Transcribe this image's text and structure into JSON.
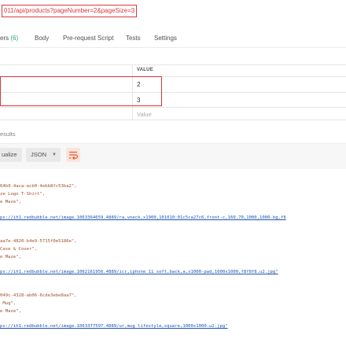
{
  "url_bar": {
    "url": "011/api/products?pageNumber=2&pageSize=3"
  },
  "tabs": [
    {
      "label": "ers ",
      "count": "(6)"
    },
    {
      "label": "Body"
    },
    {
      "label": "Pre-request Script"
    },
    {
      "label": "Tests"
    },
    {
      "label": "Settings"
    }
  ],
  "params": {
    "value_header": "VALUE",
    "rows": [
      "2",
      "3"
    ],
    "value_placeholder": "Value"
  },
  "response": {
    "results_label": "esults",
    "visualize_label": "ualize",
    "format": "JSON",
    "lines": [
      {
        "text": "64b9-4aca-acb0-4ebb8fc53ba2\","
      },
      {
        "text": "ze Logo T-Shirt\","
      },
      {
        "text": "e Maze\","
      },
      {
        "text": "ps://ih1.redbubble.net/image.1063364659.4889/ra,vneck,x1900,101010:01c5ca27c6,front-c,160,70,1000,1000-bg,f8"
      },
      {
        "text": "aa7e-4820-b4e9-5715f0e5186e\","
      },
      {
        "text": "Case & Cover\","
      },
      {
        "text": "e Maze\","
      },
      {
        "text": "ps://ih1.redbubble.net/image.1062161956.4889/icr,iphone_11_soft,back,a,x1000-pad,1000x1000,f8f8f8.u2.jpg\""
      },
      {
        "text": "049c-4328-ab06-6cde3ebe8aa7\","
      },
      {
        "text": " Mug\","
      },
      {
        "text": "e Maze\","
      },
      {
        "text": "ps://ih1.redbubble.net/image.1063377597.4889/ur,mug_lifestyle,square,1000x1000.u2.jpg\""
      }
    ]
  },
  "colors": {
    "highlight": "#d9383a",
    "accent": "#e8572a",
    "link": "#2a60c9"
  }
}
